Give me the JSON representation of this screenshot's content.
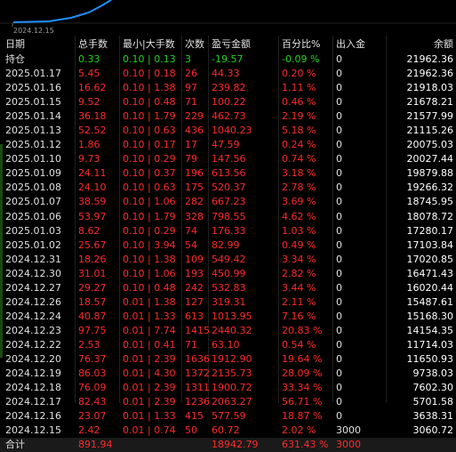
{
  "chart": {
    "date_label": "2024.12.15"
  },
  "headers": {
    "date": "日期",
    "total": "总手数",
    "minmax": "最小|大手数",
    "count": "次数",
    "pnl": "盈亏金额",
    "pct": "百分比%",
    "inout": "出入金",
    "balance": "余额"
  },
  "holding": {
    "date": "持仓",
    "total": "0.33",
    "minmax": "0.10 | 0.13",
    "count": "3",
    "pnl": "-19.57",
    "pct": "-0.09 %",
    "inout": "0",
    "balance": "21962.36"
  },
  "rows": [
    {
      "date": "2025.01.17",
      "total": "5.45",
      "minmax": "0.10 | 0.18",
      "count": "26",
      "pnl": "44.33",
      "pct": "0.20 %",
      "inout": "0",
      "balance": "21962.36"
    },
    {
      "date": "2025.01.16",
      "total": "16.62",
      "minmax": "0.10 | 1.38",
      "count": "97",
      "pnl": "239.82",
      "pct": "1.11 %",
      "inout": "0",
      "balance": "21918.03"
    },
    {
      "date": "2025.01.15",
      "total": "9.52",
      "minmax": "0.10 | 0.48",
      "count": "71",
      "pnl": "100.22",
      "pct": "0.46 %",
      "inout": "0",
      "balance": "21678.21"
    },
    {
      "date": "2025.01.14",
      "total": "36.18",
      "minmax": "0.10 | 1.79",
      "count": "229",
      "pnl": "462.73",
      "pct": "2.19 %",
      "inout": "0",
      "balance": "21577.99"
    },
    {
      "date": "2025.01.13",
      "total": "52.52",
      "minmax": "0.10 | 0.63",
      "count": "436",
      "pnl": "1040.23",
      "pct": "5.18 %",
      "inout": "0",
      "balance": "21115.26"
    },
    {
      "date": "2025.01.12",
      "total": "1.86",
      "minmax": "0.10 | 0.17",
      "count": "17",
      "pnl": "47.59",
      "pct": "0.24 %",
      "inout": "0",
      "balance": "20075.03"
    },
    {
      "date": "2025.01.10",
      "total": "9.73",
      "minmax": "0.10 | 0.29",
      "count": "79",
      "pnl": "147.56",
      "pct": "0.74 %",
      "inout": "0",
      "balance": "20027.44"
    },
    {
      "date": "2025.01.09",
      "total": "24.11",
      "minmax": "0.10 | 0.37",
      "count": "196",
      "pnl": "613.56",
      "pct": "3.18 %",
      "inout": "0",
      "balance": "19879.88"
    },
    {
      "date": "2025.01.08",
      "total": "24.10",
      "minmax": "0.10 | 0.63",
      "count": "175",
      "pnl": "520.37",
      "pct": "2.78 %",
      "inout": "0",
      "balance": "19266.32"
    },
    {
      "date": "2025.01.07",
      "total": "38.59",
      "minmax": "0.10 | 1.06",
      "count": "282",
      "pnl": "667.23",
      "pct": "3.69 %",
      "inout": "0",
      "balance": "18745.95"
    },
    {
      "date": "2025.01.06",
      "total": "53.97",
      "minmax": "0.10 | 1.79",
      "count": "328",
      "pnl": "798.55",
      "pct": "4.62 %",
      "inout": "0",
      "balance": "18078.72"
    },
    {
      "date": "2025.01.03",
      "total": "8.62",
      "minmax": "0.10 | 0.29",
      "count": "74",
      "pnl": "176.33",
      "pct": "1.03 %",
      "inout": "0",
      "balance": "17280.17"
    },
    {
      "date": "2025.01.02",
      "total": "25.67",
      "minmax": "0.10 | 3.94",
      "count": "54",
      "pnl": "82.99",
      "pct": "0.49 %",
      "inout": "0",
      "balance": "17103.84"
    },
    {
      "date": "2024.12.31",
      "total": "18.26",
      "minmax": "0.10 | 1.38",
      "count": "109",
      "pnl": "549.42",
      "pct": "3.34 %",
      "inout": "0",
      "balance": "17020.85"
    },
    {
      "date": "2024.12.30",
      "total": "31.01",
      "minmax": "0.10 | 1.06",
      "count": "193",
      "pnl": "450.99",
      "pct": "2.82 %",
      "inout": "0",
      "balance": "16471.43"
    },
    {
      "date": "2024.12.27",
      "total": "29.27",
      "minmax": "0.10 | 0.48",
      "count": "242",
      "pnl": "532.83",
      "pct": "3.44 %",
      "inout": "0",
      "balance": "16020.44"
    },
    {
      "date": "2024.12.26",
      "total": "18.57",
      "minmax": "0.01 | 1.38",
      "count": "127",
      "pnl": "319.31",
      "pct": "2.11 %",
      "inout": "0",
      "balance": "15487.61"
    },
    {
      "date": "2024.12.24",
      "total": "40.87",
      "minmax": "0.01 | 1.33",
      "count": "613",
      "pnl": "1013.95",
      "pct": "7.16 %",
      "inout": "0",
      "balance": "15168.30"
    },
    {
      "date": "2024.12.23",
      "total": "97.75",
      "minmax": "0.01 | 7.74",
      "count": "1415",
      "pnl": "2440.32",
      "pct": "20.83 %",
      "inout": "0",
      "balance": "14154.35"
    },
    {
      "date": "2024.12.22",
      "total": "2.53",
      "minmax": "0.01 | 0.41",
      "count": "71",
      "pnl": "63.10",
      "pct": "0.54 %",
      "inout": "0",
      "balance": "11714.03"
    },
    {
      "date": "2024.12.20",
      "total": "76.37",
      "minmax": "0.01 | 2.39",
      "count": "1636",
      "pnl": "1912.90",
      "pct": "19.64 %",
      "inout": "0",
      "balance": "11650.93"
    },
    {
      "date": "2024.12.19",
      "total": "86.03",
      "minmax": "0.01 | 4.30",
      "count": "1372",
      "pnl": "2135.73",
      "pct": "28.09 %",
      "inout": "0",
      "balance": "9738.03"
    },
    {
      "date": "2024.12.18",
      "total": "76.09",
      "minmax": "0.01 | 2.39",
      "count": "1311",
      "pnl": "1900.72",
      "pct": "33.34 %",
      "inout": "0",
      "balance": "7602.30"
    },
    {
      "date": "2024.12.17",
      "total": "82.43",
      "minmax": "0.01 | 2.39",
      "count": "1236",
      "pnl": "2063.27",
      "pct": "56.71 %",
      "inout": "0",
      "balance": "5701.58"
    },
    {
      "date": "2024.12.16",
      "total": "23.07",
      "minmax": "0.01 | 1.33",
      "count": "415",
      "pnl": "577.59",
      "pct": "18.87 %",
      "inout": "0",
      "balance": "3638.31"
    },
    {
      "date": "2024.12.15",
      "total": "2.42",
      "minmax": "0.01 | 0.74",
      "count": "50",
      "pnl": "60.72",
      "pct": "2.02 %",
      "inout": "3000",
      "balance": "3060.72"
    }
  ],
  "summary": {
    "label": "合计",
    "total": "891.94",
    "pnl": "18942.79",
    "pct": "631.43 %",
    "inout": "3000"
  },
  "colors": {
    "positive": "#ff2a2a",
    "negative": "#1fd31f",
    "line": "#1e90ff"
  }
}
